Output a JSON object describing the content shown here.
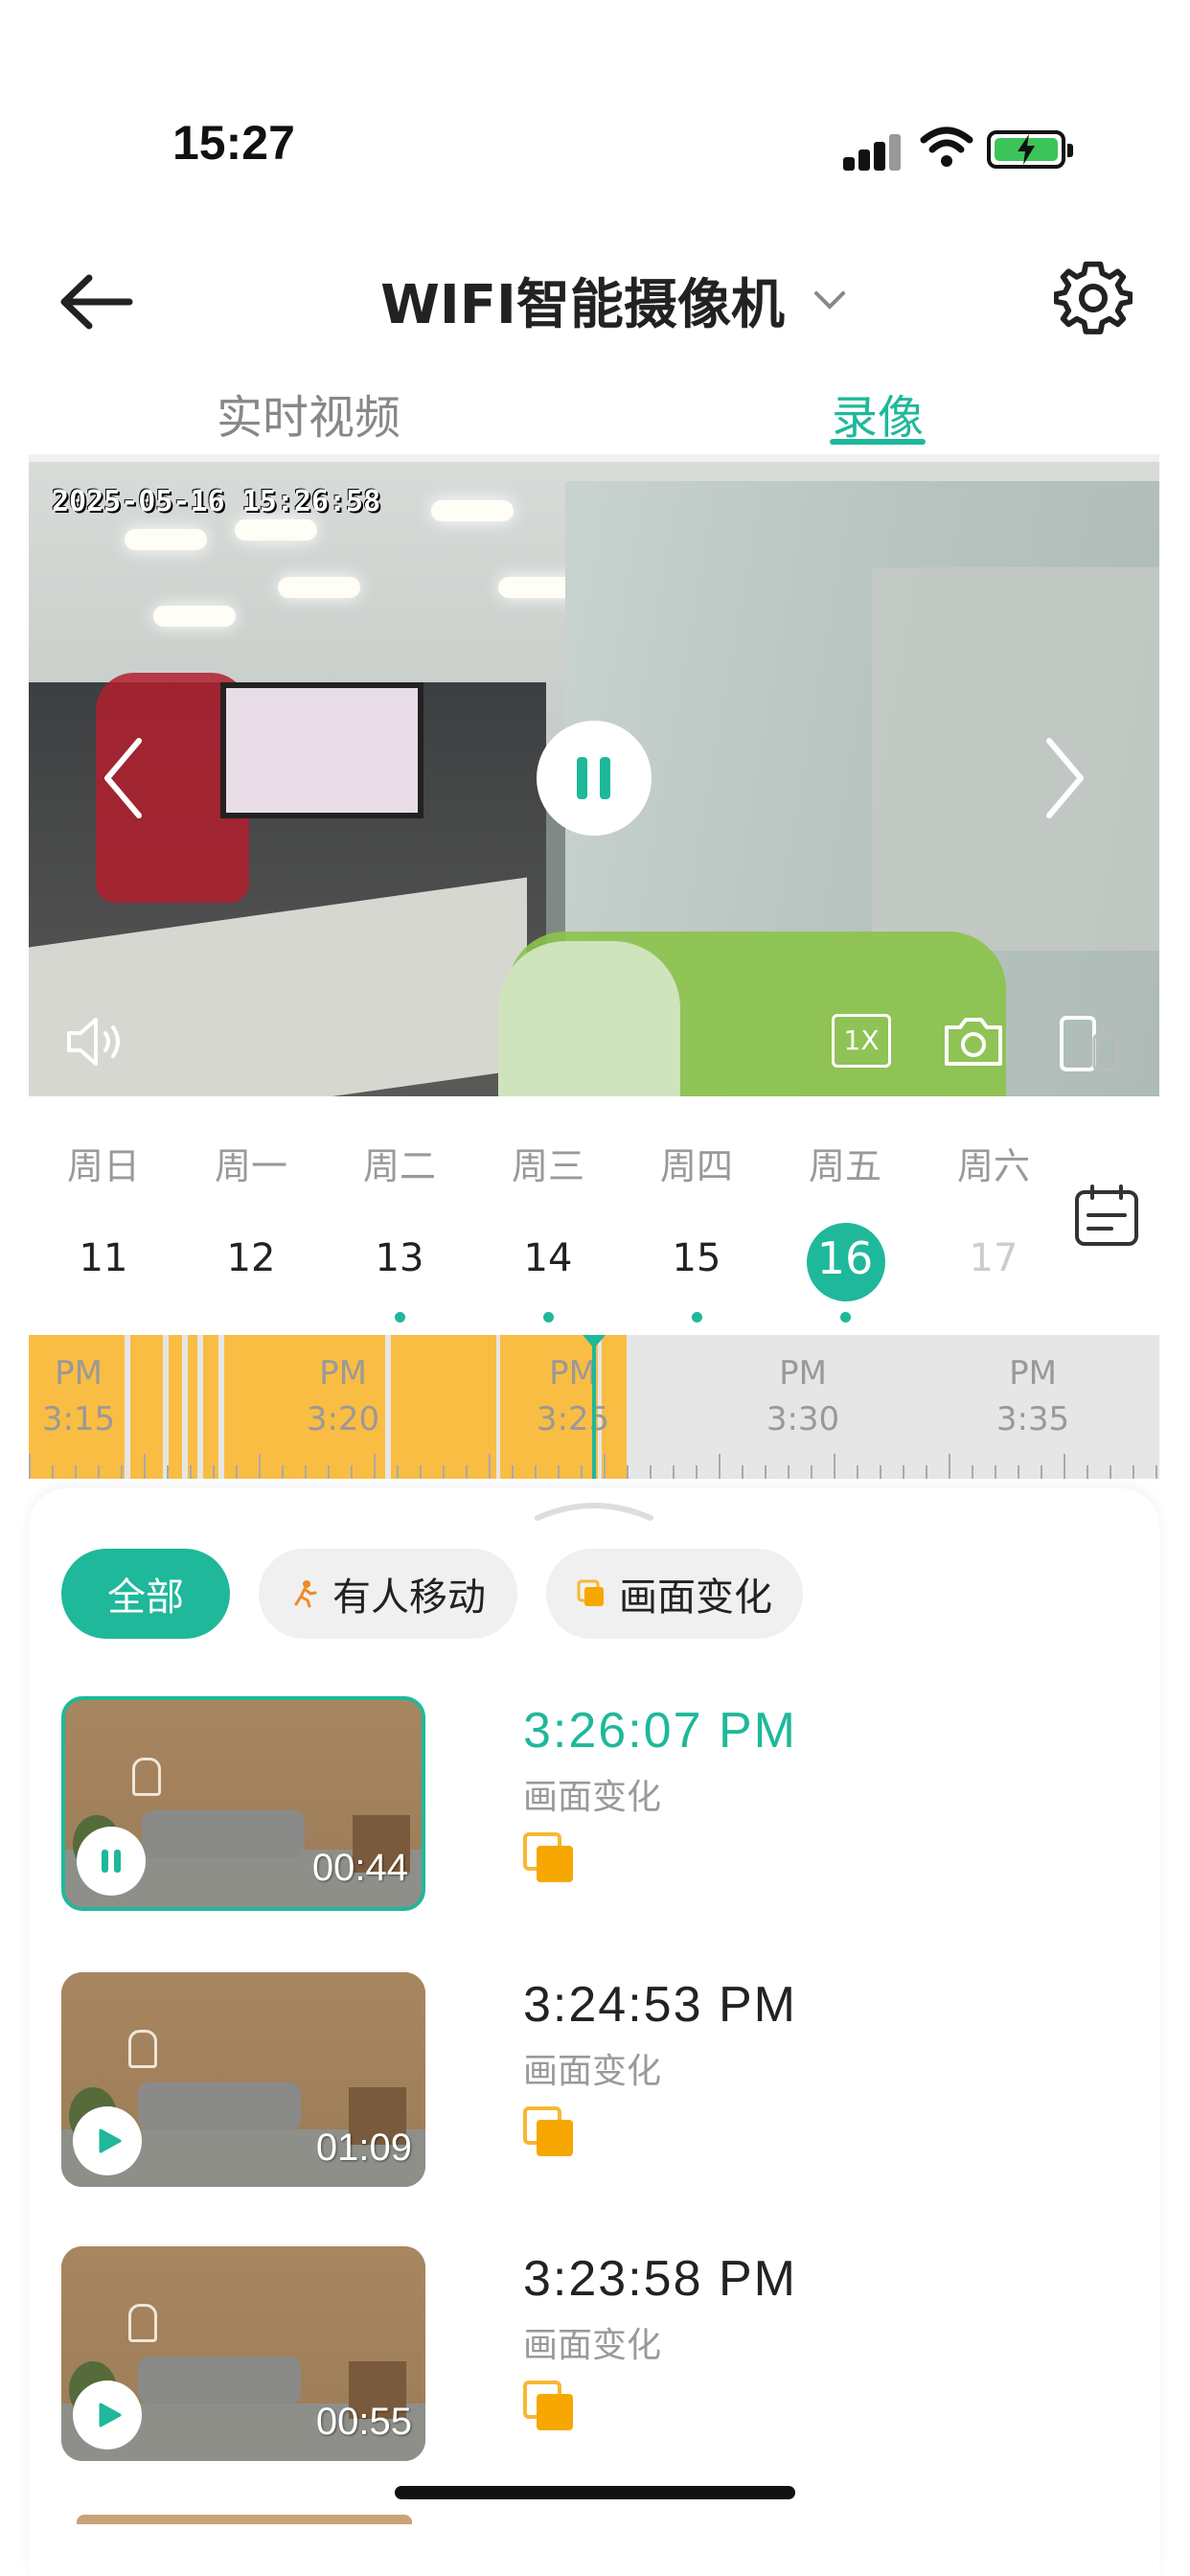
{
  "status_bar": {
    "time": "15:27"
  },
  "header": {
    "title": "WIFI智能摄像机",
    "icons": [
      "back-arrow-icon",
      "chevron-down-icon",
      "gear-icon"
    ]
  },
  "tabs": [
    {
      "label": "实时视频",
      "active": false
    },
    {
      "label": "录像",
      "active": true
    }
  ],
  "player": {
    "timestamp": "2025-05-16 15:26:58",
    "state": "playing",
    "speed": "1X",
    "controls": [
      "volume-icon",
      "speed-1x-icon",
      "camera-icon",
      "rotate-screen-icon"
    ]
  },
  "week": {
    "days": [
      "周日",
      "周一",
      "周二",
      "周三",
      "周四",
      "周五",
      "周六"
    ],
    "dates": [
      "11",
      "12",
      "13",
      "14",
      "15",
      "16",
      "17"
    ],
    "selected": "16",
    "has_recordings": [
      "13",
      "14",
      "15",
      "16"
    ]
  },
  "timeline": {
    "labels": [
      {
        "period": "PM",
        "time": "3:15"
      },
      {
        "period": "PM",
        "time": "3:20"
      },
      {
        "period": "PM",
        "time": "3:25"
      },
      {
        "period": "PM",
        "time": "3:30"
      },
      {
        "period": "PM",
        "time": "3:35"
      }
    ]
  },
  "filters": [
    {
      "label": "全部",
      "active": true
    },
    {
      "label": "有人移动",
      "active": false,
      "icon": "person-moving-icon"
    },
    {
      "label": "画面变化",
      "active": false,
      "icon": "scene-change-icon"
    }
  ],
  "recordings": [
    {
      "time": "3:26:07 PM",
      "type": "画面变化",
      "duration": "00:44",
      "selected": true,
      "state": "playing"
    },
    {
      "time": "3:24:53 PM",
      "type": "画面变化",
      "duration": "01:09",
      "selected": false,
      "state": "paused"
    },
    {
      "time": "3:23:58 PM",
      "type": "画面变化",
      "duration": "00:55",
      "selected": false,
      "state": "paused"
    }
  ],
  "colors": {
    "accent": "#1fb89a",
    "recording": "#f9bd44",
    "scene_change": "#f7a800"
  }
}
